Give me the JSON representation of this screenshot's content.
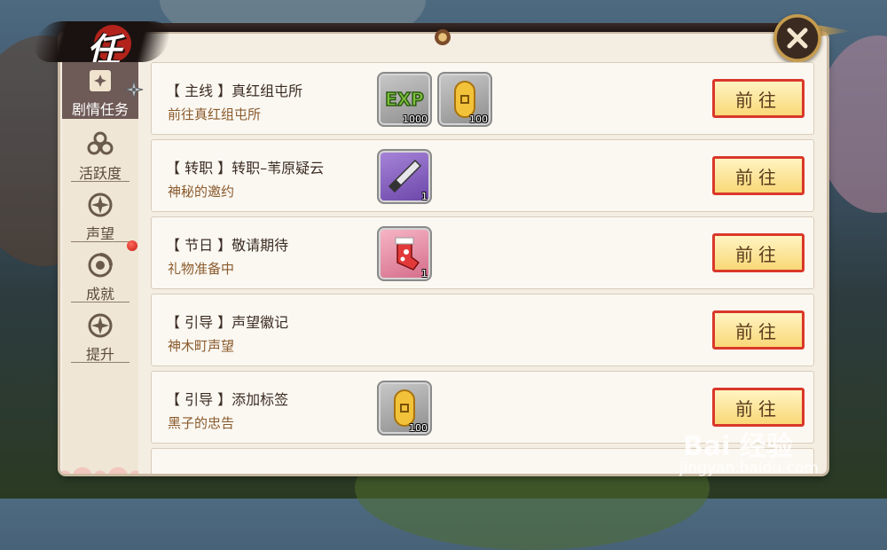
{
  "window": {
    "title": "任务"
  },
  "sidebar": {
    "items": [
      {
        "label": "剧情任务",
        "icon": "shuriken-scroll-icon",
        "active": true
      },
      {
        "label": "活跃度",
        "icon": "flower-crest-icon"
      },
      {
        "label": "声望",
        "icon": "crest-icon"
      },
      {
        "label": "成就",
        "icon": "tomoe-crest-icon"
      },
      {
        "label": "提升",
        "icon": "crest-icon"
      }
    ]
  },
  "tasks": [
    {
      "title": "【 主线 】真红组屯所",
      "subtitle": "前往真红组屯所",
      "rewards": [
        {
          "icon": "exp-icon",
          "count": "1000"
        },
        {
          "icon": "gold-coin-icon",
          "count": "100"
        }
      ],
      "button": "前往"
    },
    {
      "title": "【 转职 】转职–苇原疑云",
      "subtitle": "神秘的邀约",
      "rewards": [
        {
          "icon": "kunai-dagger-icon",
          "count": "1"
        }
      ],
      "button": "前往"
    },
    {
      "title": "【 节日 】敬请期待",
      "subtitle": "礼物准备中",
      "rewards": [
        {
          "icon": "christmas-stocking-icon",
          "count": "1"
        }
      ],
      "button": "前往"
    },
    {
      "title": "【 引导 】声望徽记",
      "subtitle": "神木町声望",
      "rewards": [],
      "button": "前往"
    },
    {
      "title": "【 引导 】添加标签",
      "subtitle": "黑子的忠告",
      "rewards": [
        {
          "icon": "gold-coin-icon",
          "count": "100"
        }
      ],
      "button": "前往"
    }
  ],
  "watermark": {
    "brand": "Bai 经验",
    "url": "jingyan.baidu.com"
  },
  "colors": {
    "button_border": "#d9382a",
    "button_fill": "#f9d877",
    "panel": "#f4ede2",
    "active_tab": "#6e5a56"
  }
}
